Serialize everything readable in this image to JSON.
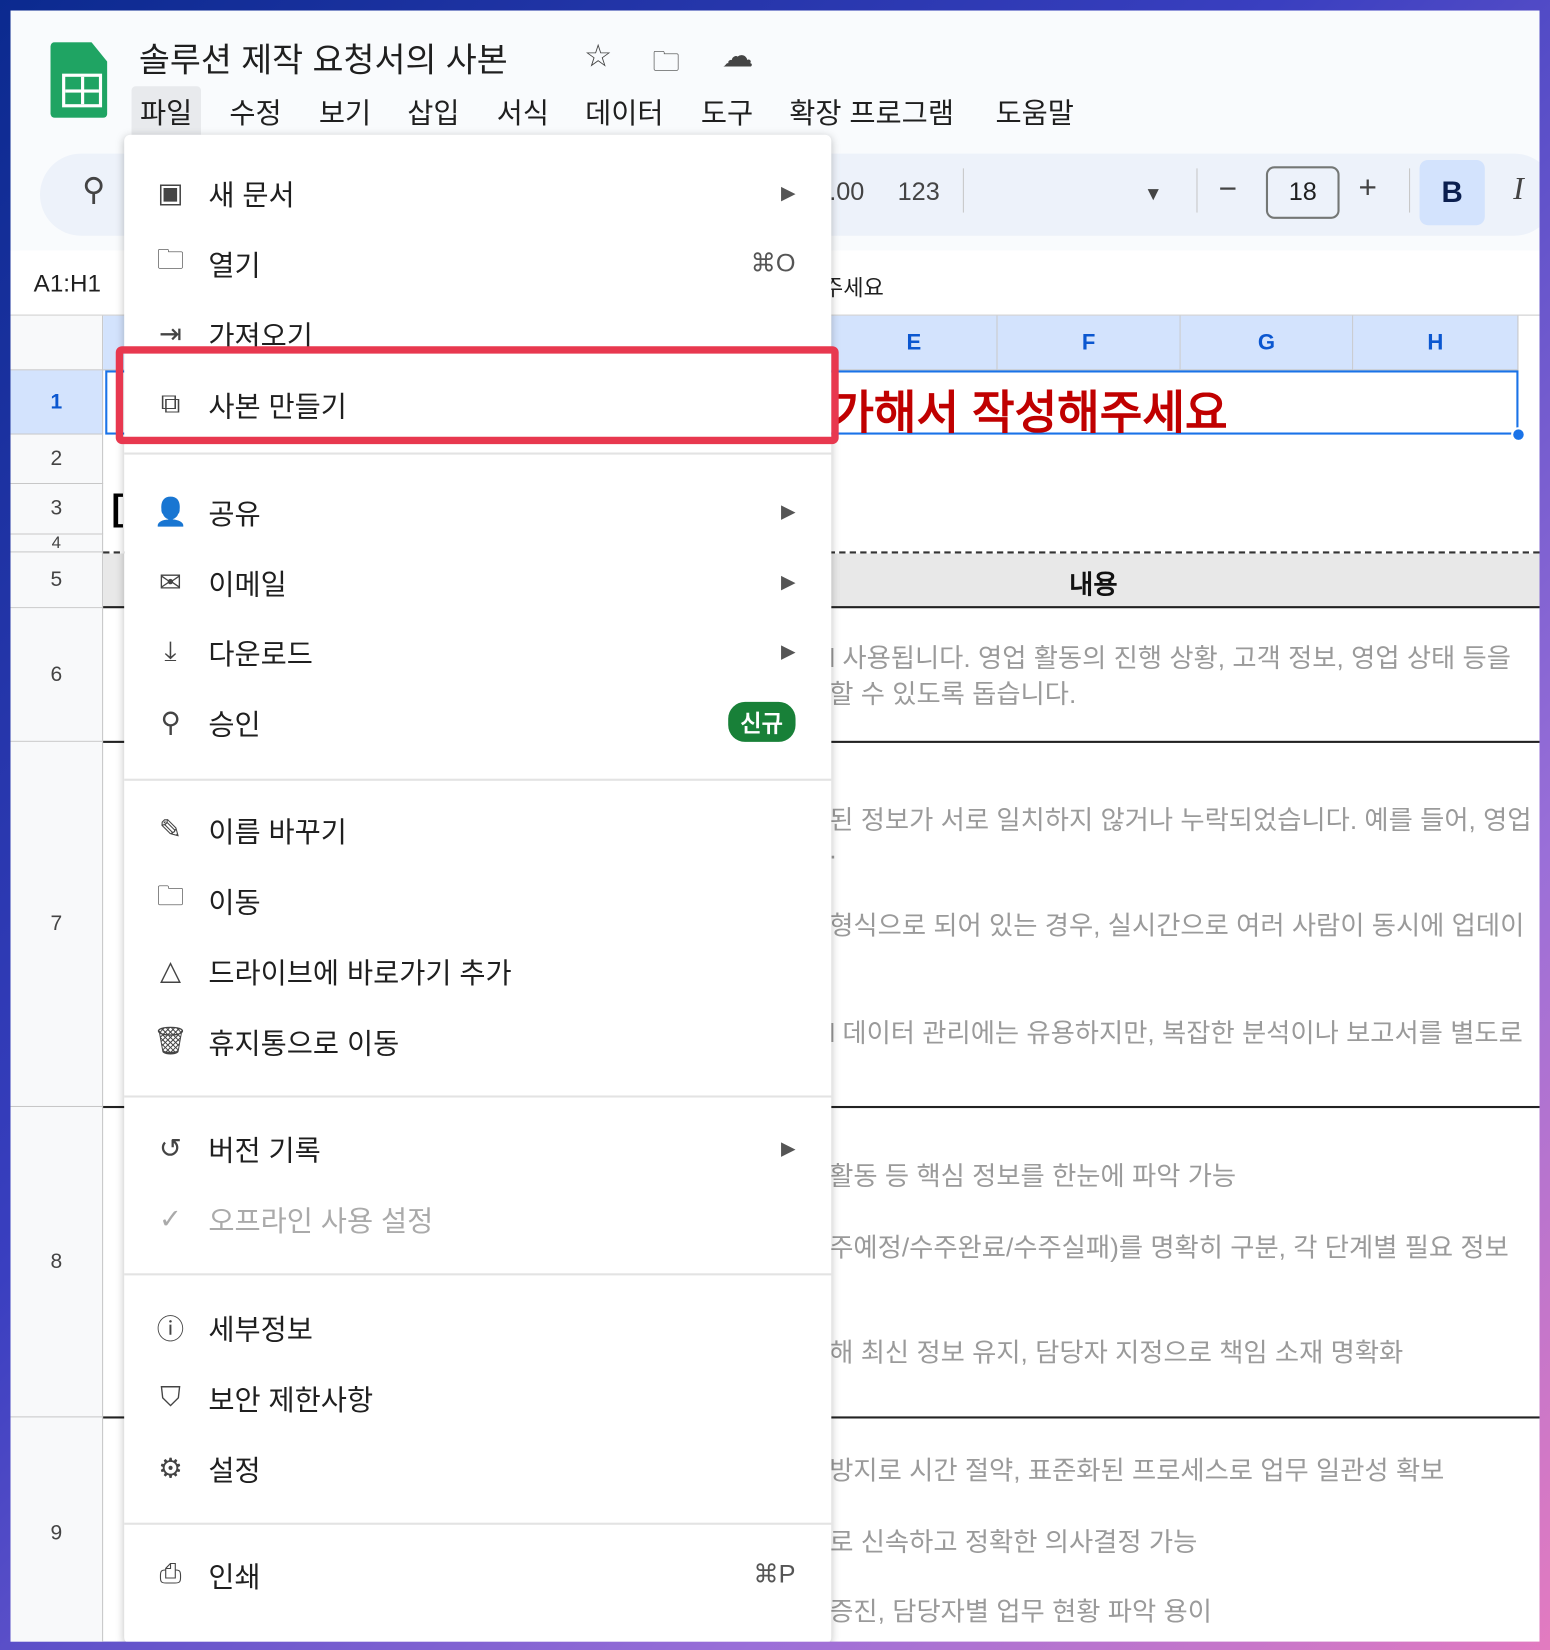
{
  "app": {
    "title": "솔루션 제작 요청서의 사본",
    "icons": [
      "star-icon",
      "move-folder-icon",
      "cloud-saved-icon"
    ]
  },
  "menubar": [
    "파일",
    "수정",
    "보기",
    "삽입",
    "서식",
    "데이터",
    "도구",
    "확장 프로그램",
    "도움말"
  ],
  "toolbar": {
    "decimal": ".00",
    "format": "123",
    "font_size": "18",
    "bold": "B",
    "italic": "I",
    "minus": "−",
    "plus": "+"
  },
  "formula": {
    "range": "A1:H1",
    "content_fragment": "주세요"
  },
  "columns": [
    "E",
    "F",
    "G",
    "H"
  ],
  "rows": [
    "1",
    "2",
    "3",
    "4",
    "5",
    "6",
    "7",
    "8",
    "9"
  ],
  "cells": {
    "title_fragment": "가해서 작성해주세요",
    "row3_fragment": "[",
    "header_content": "내용",
    "r6": [
      "l 사용됩니다. 영업 활동의 진행 상황, 고객 정보, 영업 상태 등을",
      "할 수 있도록 돕습니다."
    ],
    "r7": [
      "된 정보가 서로 일치하지 않거나 누락되었습니다. 예를 들어, 영업",
      ".",
      "형식으로 되어 있는 경우, 실시간으로 여러 사람이 동시에 업데이",
      "l 데이터 관리에는 유용하지만, 복잡한 분석이나 보고서를 별도로"
    ],
    "r8": [
      "활동 등 핵심 정보를 한눈에 파악 가능",
      "주예정/수주완료/수주실패)를 명확히 구분, 각 단계별 필요 정보",
      "해 최신 정보 유지, 담당자 지정으로 책임 소재 명확화"
    ],
    "r9": [
      "방지로 시간 절약, 표준화된 프로세스로 업무 일관성 확보",
      "로 신속하고 정확한 의사결정 가능",
      "증진, 담당자별 업무 현황 파악 용이"
    ]
  },
  "file_menu": [
    {
      "label": "새 문서",
      "icon": "new-sheet-icon",
      "submenu": true
    },
    {
      "label": "열기",
      "icon": "folder-icon",
      "shortcut": "⌘O"
    },
    {
      "label": "가져오기",
      "icon": "import-icon"
    },
    {
      "label": "사본 만들기",
      "icon": "copy-icon",
      "highlighted": true
    },
    {
      "label": "공유",
      "icon": "share-person-icon",
      "submenu": true
    },
    {
      "label": "이메일",
      "icon": "email-icon",
      "submenu": true
    },
    {
      "label": "다운로드",
      "icon": "download-icon",
      "submenu": true
    },
    {
      "label": "승인",
      "icon": "approval-icon",
      "badge": "신규"
    },
    {
      "label": "이름 바꾸기",
      "icon": "rename-icon"
    },
    {
      "label": "이동",
      "icon": "move-folder-icon"
    },
    {
      "label": "드라이브에 바로가기 추가",
      "icon": "drive-shortcut-icon"
    },
    {
      "label": "휴지통으로 이동",
      "icon": "trash-icon"
    },
    {
      "label": "버전 기록",
      "icon": "history-icon",
      "submenu": true
    },
    {
      "label": "오프라인 사용 설정",
      "icon": "offline-icon",
      "disabled": true
    },
    {
      "label": "세부정보",
      "icon": "info-icon"
    },
    {
      "label": "보안 제한사항",
      "icon": "security-icon"
    },
    {
      "label": "설정",
      "icon": "gear-icon"
    },
    {
      "label": "인쇄",
      "icon": "print-icon",
      "shortcut": "⌘P"
    }
  ],
  "colors": {
    "highlight": "#e8384f",
    "sheets_green": "#1fa463",
    "title_red": "#c00000",
    "badge_green": "#188038",
    "selection_blue": "#1a73e8"
  }
}
